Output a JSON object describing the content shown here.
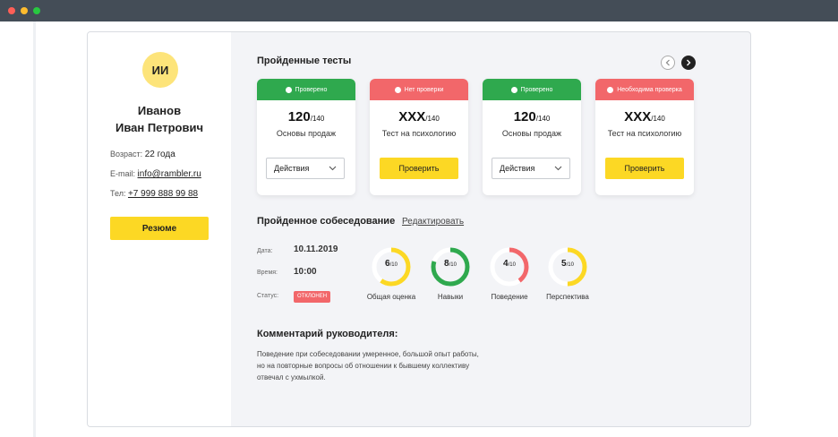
{
  "profile": {
    "initials": "ИИ",
    "last_name": "Иванов",
    "full_name": "Иван Петрович",
    "age_label": "Возраст:",
    "age_value": "22 года",
    "email_label": "E-mail:",
    "email_value": "info@rambler.ru",
    "phone_label": "Тел:",
    "phone_value": "+7 999 888 99 88",
    "resume_button": "Резюме"
  },
  "tests": {
    "title": "Пройденные тесты",
    "cards": [
      {
        "status": "Проверено",
        "status_type": "ok",
        "score": "120",
        "total": "/140",
        "name": "Основы продаж",
        "action": "Действия",
        "action_type": "select"
      },
      {
        "status": "Нет проверки",
        "status_type": "warn",
        "score": "XXX",
        "total": "/140",
        "name": "Тест на психологию",
        "action": "Проверить",
        "action_type": "button"
      },
      {
        "status": "Проверено",
        "status_type": "ok",
        "score": "120",
        "total": "/140",
        "name": "Основы продаж",
        "action": "Действия",
        "action_type": "select"
      },
      {
        "status": "Необходима проверка",
        "status_type": "warn",
        "score": "XXX",
        "total": "/140",
        "name": "Тест на психологию",
        "action": "Проверить",
        "action_type": "button"
      }
    ]
  },
  "interview": {
    "title": "Пройденное собеседование",
    "edit_link": "Редактировать",
    "date_label": "Дата:",
    "date_value": "10.11.2019",
    "time_label": "Время:",
    "time_value": "10:00",
    "status_label": "Статус:",
    "status_value": "ОТКЛОНЕН",
    "scores": [
      {
        "value": "6",
        "of": "/10",
        "label": "Общая оценка",
        "fraction": 0.6,
        "color": "#fcd824"
      },
      {
        "value": "8",
        "of": "/10",
        "label": "Навыки",
        "fraction": 0.8,
        "color": "#2fa94e"
      },
      {
        "value": "4",
        "of": "/10",
        "label": "Поведение",
        "fraction": 0.4,
        "color": "#f2676a"
      },
      {
        "value": "5",
        "of": "/10",
        "label": "Перспектива",
        "fraction": 0.5,
        "color": "#fcd824"
      }
    ]
  },
  "comment": {
    "title": "Комментарий руководителя:",
    "line1": "Поведение при собеседовании умеренное, большой опыт работы,",
    "line2": "но на повторные вопросы об отношении к бывшему коллективу",
    "line3": "отвечал с ухмылкой."
  },
  "colors": {
    "accent_yellow": "#fcd824",
    "ok_green": "#2fa94e",
    "warn_red": "#f2676a"
  }
}
